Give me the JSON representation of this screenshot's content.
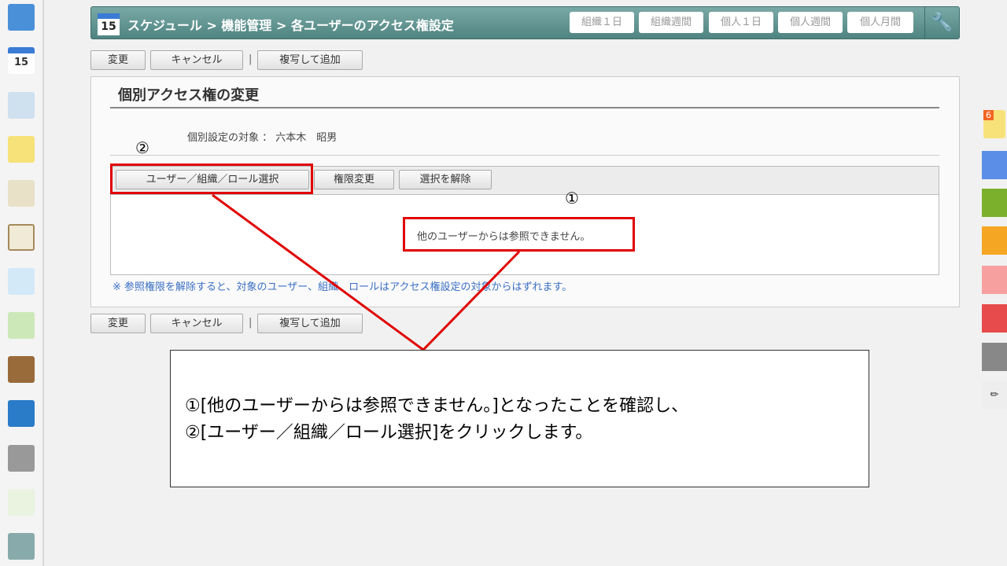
{
  "sidebar": {
    "icons": [
      "portal-icon",
      "schedule-icon",
      "facility-icon",
      "memo-icon",
      "bulletin-icon",
      "report-icon",
      "survey-icon",
      "workflow-icon",
      "cabinet-icon",
      "neo-icon",
      "folder-icon",
      "banner-icon-1",
      "banner-icon-2"
    ],
    "schedule_day": "15"
  },
  "header": {
    "day": "15",
    "breadcrumb": "スケジュール > 機能管理 > 各ユーザーのアクセス権設定",
    "views": [
      "組織１日",
      "組織週間",
      "個人１日",
      "個人週間",
      "個人月間"
    ]
  },
  "actions": {
    "change": "変更",
    "cancel": "キャンセル",
    "separator": "|",
    "copy_add": "複写して追加"
  },
  "panel": {
    "title": "個別アクセス権の変更",
    "target_label": "個別設定の対象 ： 六本木　昭男",
    "toolbar": {
      "select": "ユーザー／組織／ロール選択",
      "change_perm": "権限変更",
      "deselect": "選択を解除"
    },
    "message": "他のユーザーからは参照できません。",
    "note": "※ 参照権限を解除すると、対象のユーザー、組織、ロールはアクセス権設定の対象からはずれます。"
  },
  "annotation": {
    "marker1": "①",
    "marker2": "②",
    "line1": "①[他のユーザーからは参照できません。]となったことを確認し、",
    "line2": "②[ユーザー／組織／ロール選択]をクリックします。"
  },
  "right_sidebar": {
    "badge": "6",
    "tab_colors": [
      "#5b8ee6",
      "#7ab02c",
      "#f5a623",
      "#f7a0a0",
      "#e84b4b",
      "#888888"
    ]
  }
}
